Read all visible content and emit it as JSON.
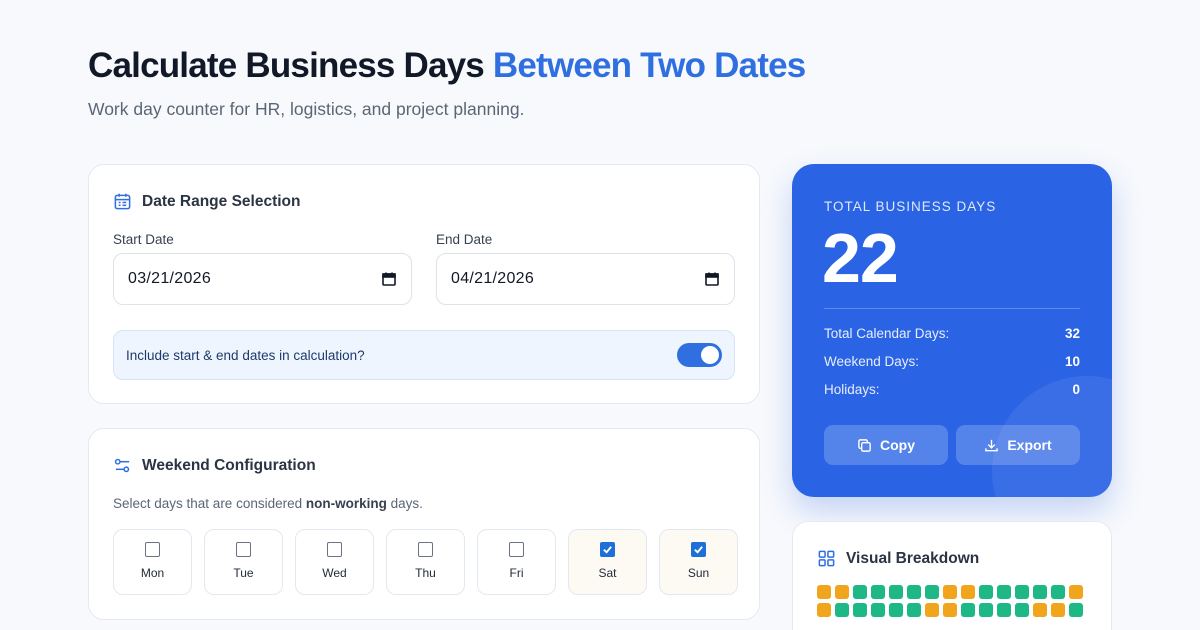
{
  "header": {
    "title_main": "Calculate Business Days",
    "title_accent": "Between Two Dates",
    "subtitle": "Work day counter for HR, logistics, and project planning."
  },
  "date_range": {
    "title": "Date Range Selection",
    "start_label": "Start Date",
    "start_value": "03/21/2026",
    "end_label": "End Date",
    "end_value": "04/21/2026",
    "include_label": "Include start & end dates in calculation?",
    "include_enabled": true
  },
  "weekend": {
    "title": "Weekend Configuration",
    "desc_prefix": "Select days that are considered",
    "desc_bold": "non-working",
    "desc_suffix": "days.",
    "days": [
      {
        "label": "Mon",
        "checked": false
      },
      {
        "label": "Tue",
        "checked": false
      },
      {
        "label": "Wed",
        "checked": false
      },
      {
        "label": "Thu",
        "checked": false
      },
      {
        "label": "Fri",
        "checked": false
      },
      {
        "label": "Sat",
        "checked": true
      },
      {
        "label": "Sun",
        "checked": true
      }
    ]
  },
  "result": {
    "label": "TOTAL BUSINESS DAYS",
    "value": "22",
    "stats": [
      {
        "label": "Total Calendar Days:",
        "value": "32"
      },
      {
        "label": "Weekend Days:",
        "value": "10"
      },
      {
        "label": "Holidays:",
        "value": "0"
      }
    ],
    "copy_label": "Copy",
    "export_label": "Export"
  },
  "breakdown": {
    "title": "Visual Breakdown",
    "cells": [
      "W",
      "W",
      "B",
      "B",
      "B",
      "B",
      "B",
      "W",
      "W",
      "B",
      "B",
      "B",
      "B",
      "B",
      "W",
      "W",
      "B",
      "B",
      "B",
      "B",
      "B",
      "W",
      "W",
      "B",
      "B",
      "B",
      "B",
      "W",
      "W",
      "B"
    ],
    "colors": {
      "business": "#1db885",
      "weekend": "#f1a51c"
    }
  },
  "theme": {
    "accent": "#2f6fe0",
    "result_bg": "#2a64e5"
  }
}
